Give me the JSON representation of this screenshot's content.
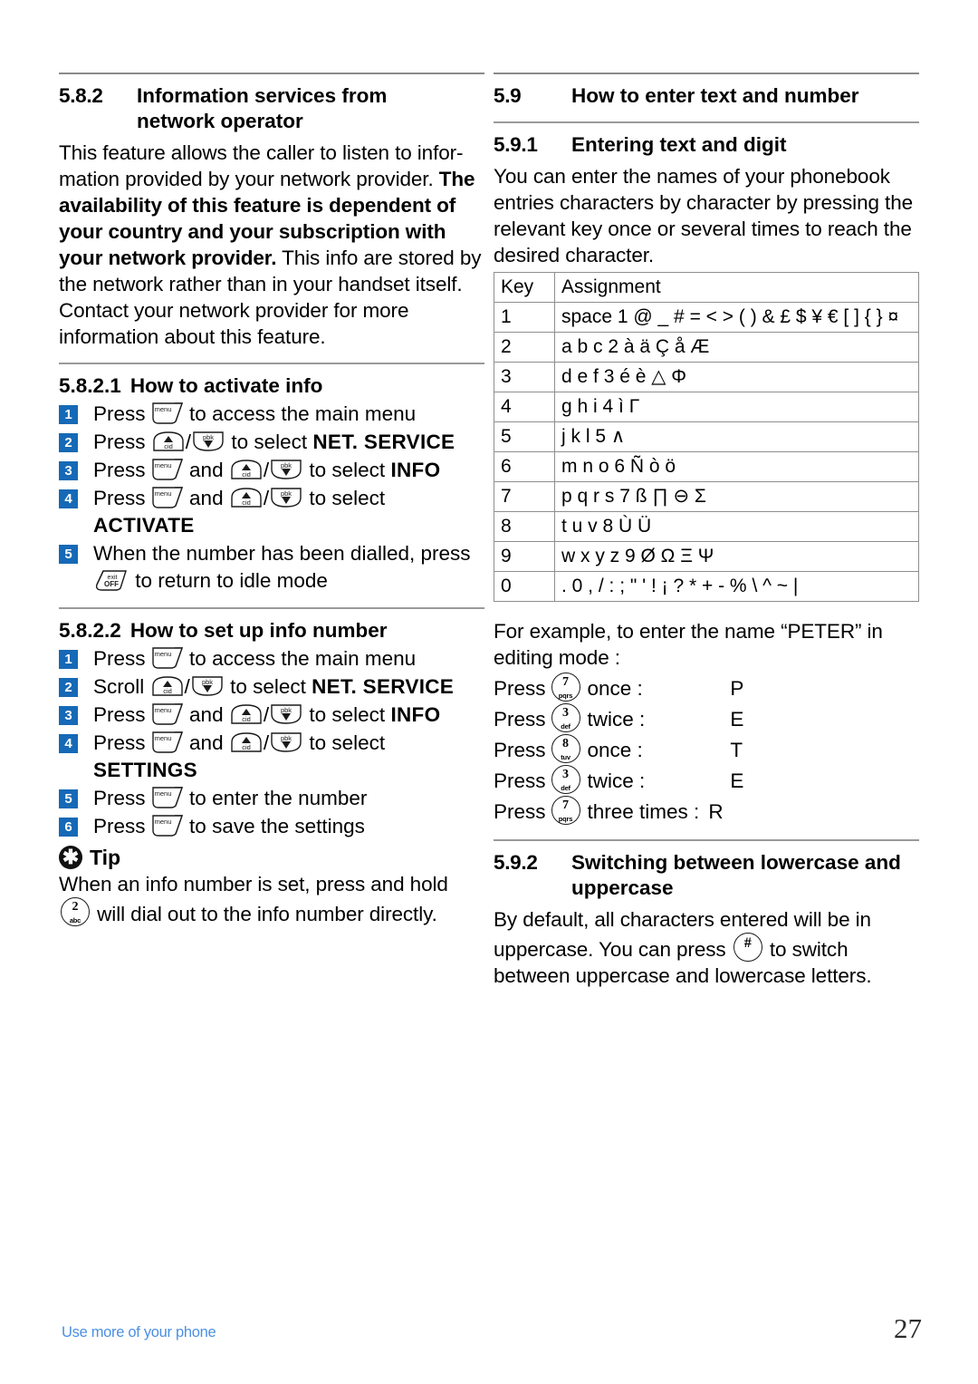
{
  "footer": {
    "chapter_label": "Use more of your phone",
    "page_number": "27",
    "link_color": "#4a90e2",
    "accent_color": "#1569b6"
  },
  "left_column": {
    "section_582": {
      "number": "5.8.2",
      "title_line1": "Information services from",
      "title_line2": "network operator",
      "para1_part1": "This feature allows the caller to listen to infor-mation provided by your network provider. ",
      "para1_bold": "The availability of this feature is dependent of your country and your subscription with your network provider.",
      "para1_part2": " This info are stored by the network rather than in your handset itself. Contact your network provider for more information about this feature."
    },
    "section_5821": {
      "number": "5.8.2.1",
      "title": "How to activate info",
      "steps": [
        {
          "n": "1",
          "pre": "Press",
          "key1": "menu",
          "post": "to access the main menu"
        },
        {
          "n": "2",
          "pre": "Press",
          "key1": "up-cid",
          "sep": "/",
          "key2": "down-pbk",
          "post": "to select",
          "bold_tail": "NET. SERVICE"
        },
        {
          "n": "3",
          "pre": "Press",
          "key1": "menu",
          "mid": "and",
          "key2": "up-cid",
          "sep": "/",
          "key3": "down-pbk",
          "post": "to select",
          "bold_tail": "INFO"
        },
        {
          "n": "4",
          "pre": "Press",
          "key1": "menu",
          "mid": "and",
          "key2": "up-cid",
          "sep": "/",
          "key3": "down-pbk",
          "post": "to select",
          "caps_line": "ACTIVATE"
        },
        {
          "n": "5",
          "pre": "When the number has been dialled, press",
          "key1": "exit-off",
          "post": "to return to idle mode"
        }
      ]
    },
    "section_5822": {
      "number": "5.8.2.2",
      "title": "How to set up info number",
      "steps": [
        {
          "n": "1",
          "pre": "Press",
          "key1": "menu",
          "post": "to access the main menu"
        },
        {
          "n": "2",
          "pre": "Scroll",
          "key1": "up-cid",
          "sep": "/",
          "key2": "down-pbk",
          "post": "to select",
          "bold_tail": "NET. SERVICE"
        },
        {
          "n": "3",
          "pre": "Press",
          "key1": "menu",
          "mid": "and",
          "key2": "up-cid",
          "sep": "/",
          "key3": "down-pbk",
          "post": "to select",
          "bold_tail": "INFO"
        },
        {
          "n": "4",
          "pre": "Press",
          "key1": "menu",
          "mid": "and",
          "key2": "up-cid",
          "sep": "/",
          "key3": "down-pbk",
          "post": "to select",
          "caps_line": "SETTINGS"
        },
        {
          "n": "5",
          "pre": "Press",
          "key1": "menu",
          "post": "to enter the number"
        },
        {
          "n": "6",
          "pre": "Press",
          "key1": "menu",
          "post": "to save the settings"
        }
      ]
    },
    "tip": {
      "icon": "asterisk-icon",
      "label": "Tip",
      "text_part1": "When an info number is set, press and hold",
      "key": {
        "digit": "2",
        "sub": "abc"
      },
      "text_part2": "will dial out to the info number directly."
    }
  },
  "right_column": {
    "section_59": {
      "number": "5.9",
      "title": "How to enter text and number"
    },
    "section_591": {
      "number": "5.9.1",
      "title": "Entering text and digit",
      "paragraph": "You can enter the names of your phonebook entries characters by character by pressing the relevant key once or several times to reach the desired character."
    },
    "key_table": {
      "headers": [
        "Key",
        "Assignment"
      ],
      "rows": [
        {
          "key": "1",
          "assignment": "space 1 @ _ # = < > ( ) & £ $ ¥ € [ ] { } ¤"
        },
        {
          "key": "2",
          "assignment": "a b c 2 à ä Ç å Æ"
        },
        {
          "key": "3",
          "assignment": "d e f 3 é è △ Φ"
        },
        {
          "key": "4",
          "assignment": "g h i 4 ì Γ"
        },
        {
          "key": "5",
          "assignment": "j k l 5 ∧"
        },
        {
          "key": "6",
          "assignment": "m n o 6 Ñ ò ö"
        },
        {
          "key": "7",
          "assignment": "p q r s 7 ß ∏ ⊖ Σ"
        },
        {
          "key": "8",
          "assignment": "t u v 8 Ù Ü"
        },
        {
          "key": "9",
          "assignment": "w x y z 9 Ø Ω Ξ Ψ"
        },
        {
          "key": "0",
          "assignment": ". 0 , / : ; \" ' ! ¡ ? * + - % \\ ^ ~ |"
        }
      ]
    },
    "example": {
      "intro": "For example, to enter the name “PETER” in editing mode :",
      "rows": [
        {
          "press": "Press",
          "key": {
            "digit": "7",
            "sub": "pqrs"
          },
          "times": "once :",
          "result": "P"
        },
        {
          "press": "Press",
          "key": {
            "digit": "3",
            "sub": "def"
          },
          "times": "twice :",
          "result": "E"
        },
        {
          "press": "Press",
          "key": {
            "digit": "8",
            "sub": "tuv"
          },
          "times": "once :",
          "result": "T"
        },
        {
          "press": "Press",
          "key": {
            "digit": "3",
            "sub": "def"
          },
          "times": "twice :",
          "result": "E"
        },
        {
          "press": "Press",
          "key": {
            "digit": "7",
            "sub": "pqrs"
          },
          "times": "three times :",
          "result": "R"
        }
      ]
    },
    "section_592": {
      "number": "5.9.2",
      "title_line1": "Switching between lowercase and",
      "title_line2": "uppercase",
      "text_part1": "By default, all characters entered will be in uppercase. You can press",
      "key": {
        "digit": "#",
        "sub": ""
      },
      "text_part2": "to switch between uppercase and lowercase letters."
    }
  }
}
